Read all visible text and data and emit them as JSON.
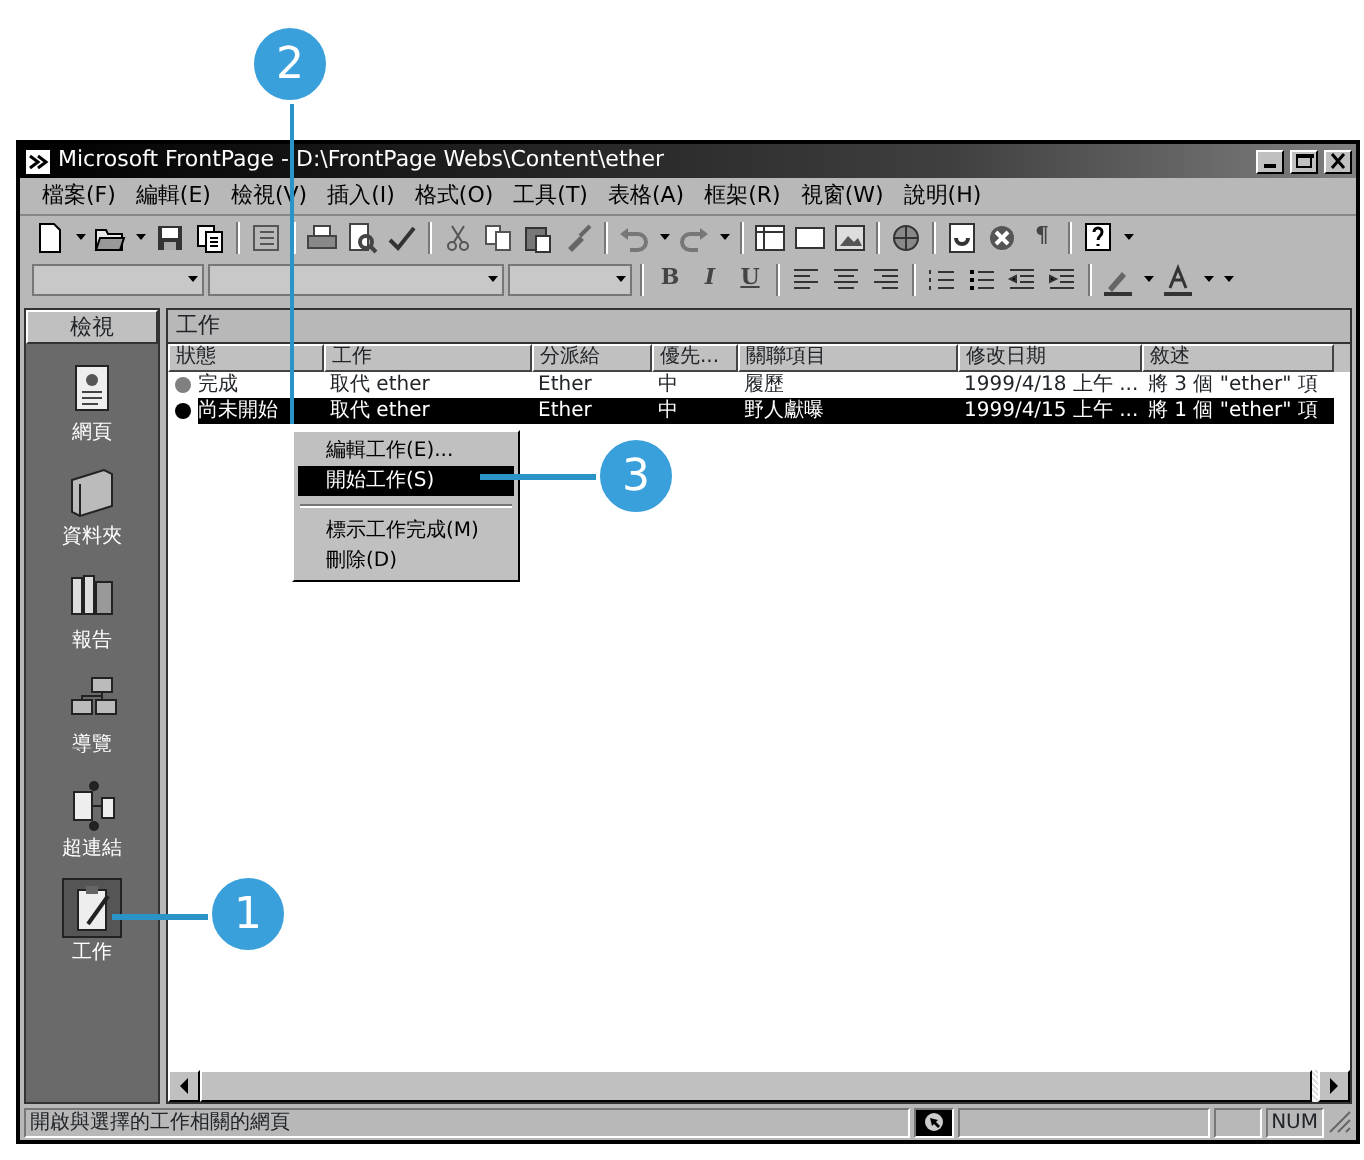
{
  "window": {
    "title": "Microsoft FrontPage - D:\\FrontPage Webs\\Content\\ether"
  },
  "menu": [
    "檔案(F)",
    "編輯(E)",
    "檢視(V)",
    "插入(I)",
    "格式(O)",
    "工具(T)",
    "表格(A)",
    "框架(R)",
    "視窗(W)",
    "說明(H)"
  ],
  "toolbar": {
    "pilcrow": "¶"
  },
  "format_toolbar": {
    "buttons": [
      "B",
      "I",
      "U"
    ]
  },
  "sidebar": {
    "title": "檢視",
    "items": [
      {
        "label": "網頁",
        "selected": false
      },
      {
        "label": "資料夾",
        "selected": false
      },
      {
        "label": "報告",
        "selected": false
      },
      {
        "label": "導覽",
        "selected": false
      },
      {
        "label": "超連結",
        "selected": false
      },
      {
        "label": "工作",
        "selected": true
      }
    ]
  },
  "panel": {
    "title": "工作"
  },
  "table": {
    "columns": [
      "狀態",
      "工作",
      "分派給",
      "優先...",
      "關聯項目",
      "修改日期",
      "敘述"
    ],
    "rows": [
      {
        "color": "#808080",
        "selected": false,
        "cells": [
          "完成",
          "取代 ether",
          "Ether",
          "中",
          "履歷",
          "1999/4/18 上午 ...",
          "將 3 個 \"ether\" 項"
        ]
      },
      {
        "color": "#000000",
        "selected": true,
        "cells": [
          "尚未開始",
          "取代 ether",
          "Ether",
          "中",
          "野人獻曝",
          "1999/4/15 上午 ...",
          "將 1 個 \"ether\" 項"
        ]
      }
    ]
  },
  "context_menu": [
    {
      "label": "編輯工作(E)...",
      "selected": false
    },
    {
      "label": "開始工作(S)",
      "selected": true
    },
    {
      "kind": "separator"
    },
    {
      "label": "標示工作完成(M)",
      "selected": false
    },
    {
      "label": "刪除(D)",
      "selected": false
    }
  ],
  "status_bar": {
    "text": "開啟與選擇的工作相關的網頁",
    "mode": "NUM"
  },
  "callouts": [
    "2",
    "3",
    "1"
  ]
}
